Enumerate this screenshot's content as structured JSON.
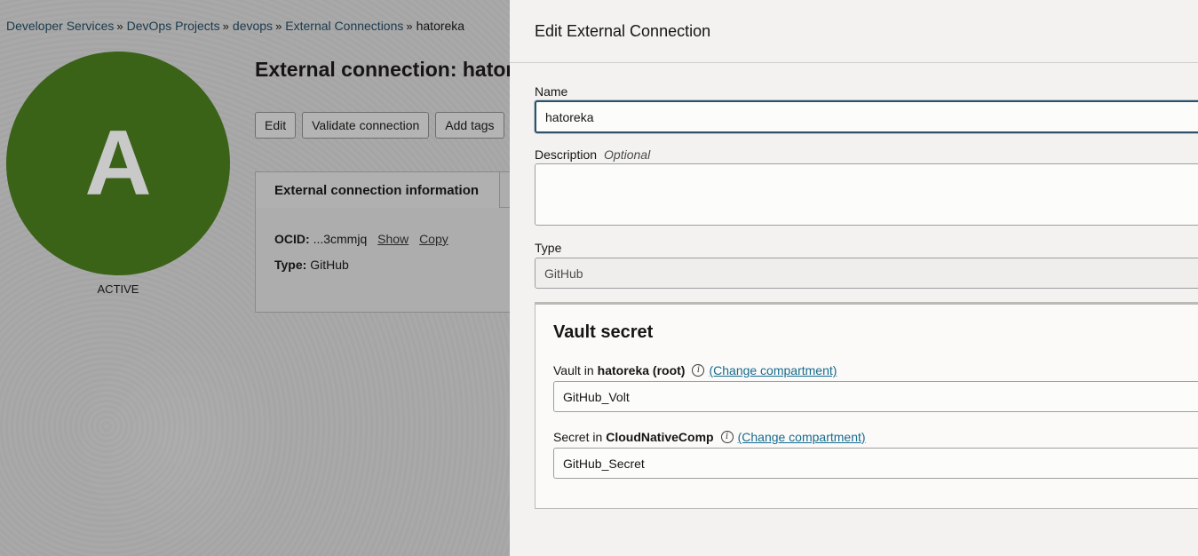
{
  "breadcrumb": {
    "items": [
      "Developer Services",
      "DevOps Projects",
      "devops",
      "External Connections"
    ],
    "current": "hatoreka",
    "separator": "»"
  },
  "resource": {
    "avatar_letter": "A",
    "status": "ACTIVE",
    "title": "External connection: hatore",
    "actions": {
      "edit": "Edit",
      "validate": "Validate connection",
      "add_tags": "Add tags"
    },
    "info_tab": "External connection information",
    "ocid_label": "OCID:",
    "ocid_value": "...3cmmjq",
    "show_link": "Show",
    "copy_link": "Copy",
    "type_label": "Type:",
    "type_value": "GitHub"
  },
  "drawer": {
    "title": "Edit External Connection",
    "name_label": "Name",
    "name_value": "hatoreka",
    "description_label": "Description",
    "description_optional": "Optional",
    "description_value": "",
    "type_label": "Type",
    "type_value": "GitHub",
    "vault": {
      "title": "Vault secret",
      "vault_label_prefix": "Vault in",
      "vault_compartment": "hatoreka (root)",
      "vault_change_link": "(Change compartment)",
      "vault_value": "GitHub_Volt",
      "secret_label_prefix": "Secret in",
      "secret_compartment": "CloudNativeComp",
      "secret_change_link": "(Change compartment)",
      "secret_value": "GitHub_Secret"
    }
  },
  "colors": {
    "avatar": "#3a6318",
    "link": "#166b8c",
    "focus_border": "#2e5168"
  }
}
